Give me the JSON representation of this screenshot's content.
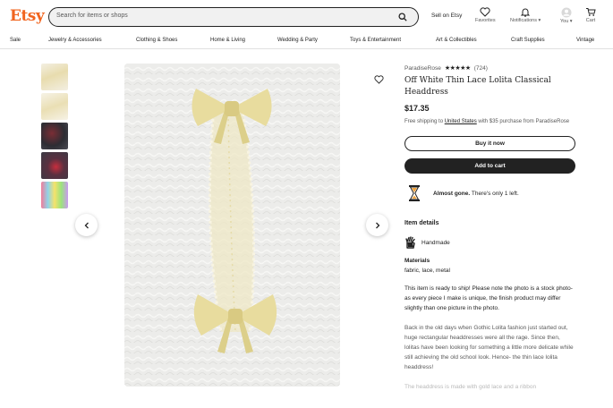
{
  "header": {
    "logo": "Etsy",
    "search_placeholder": "Search for items or shops",
    "sell_label": "Sell on Etsy",
    "favorites_label": "Favorites",
    "notifications_label": "Notifications",
    "you_label": "You",
    "cart_label": "Cart"
  },
  "nav": {
    "items": [
      "Sale",
      "Jewelry & Accessories",
      "Clothing & Shoes",
      "Home & Living",
      "Wedding & Party",
      "Toys & Entertainment",
      "Art & Collectibles",
      "Craft Supplies",
      "Vintage"
    ]
  },
  "listing": {
    "shop_name": "ParadiseRose",
    "stars_glyph": "★★★★★",
    "review_count": "(724)",
    "title": "Off White Thin Lace Lolita Classical Headdress",
    "price": "$17.35",
    "shipping_prefix": "Free shipping to",
    "shipping_country": "United States",
    "shipping_suffix": "with $35 purchase from ParadiseRose",
    "buy_now_label": "Buy it now",
    "add_to_cart_label": "Add to cart",
    "almost_gone_bold": "Almost gone.",
    "almost_gone_rest": "There's only 1 left.",
    "item_details_heading": "Item details",
    "handmade_label": "Handmade",
    "materials_heading": "Materials",
    "materials_value": "fabric, lace, metal",
    "description_1": "This item is ready to ship! Please note the photo is a stock photo- as every piece I make is unique, the finish product may differ slightly than one picture in the photo.",
    "description_2": "Back in the old days when Gothic Lolita fashion just started out, huge rectangular headdresses were all the rage. Since then, lolitas have been looking for something a little more delicate while still achieving the old school look. Hence- the thin lace lolita headdress!",
    "description_3": "The headdress is made with gold lace and a ribbon"
  },
  "colors": {
    "brand": "#f1641e",
    "button_dark": "#222222",
    "text_muted": "#595959",
    "image_bg": "#ececea",
    "ribbon": "#ece3b0"
  }
}
